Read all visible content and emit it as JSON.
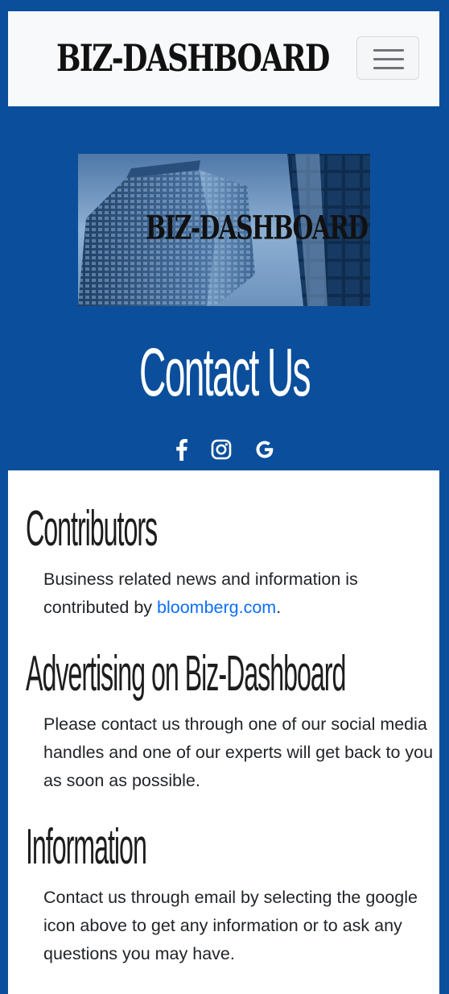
{
  "navbar": {
    "brand": "BIZ-DASHBOARD",
    "toggle_label": "Toggle navigation"
  },
  "hero": {
    "image_brand": "BIZ-DASHBOARD",
    "title": "Contact Us",
    "social_icons": [
      "facebook-icon",
      "instagram-icon",
      "google-icon"
    ]
  },
  "sections": [
    {
      "heading": "Contributors",
      "text_before": "Business related news and information is contributed by ",
      "link_text": "bloomberg.com",
      "text_after": "."
    },
    {
      "heading": "Advertising on Biz-Dashboard",
      "text": "Please contact us through one of our social media handles and one of our experts will get back to you as soon as possible."
    },
    {
      "heading": "Information",
      "text": "Contact us through email by selecting the google icon above to get any information or to ask any questions you may have."
    }
  ],
  "colors": {
    "page_background": "#0b4f9c",
    "navbar_background": "#f8f9fa",
    "link": "#0d6efd",
    "text": "#212529"
  }
}
